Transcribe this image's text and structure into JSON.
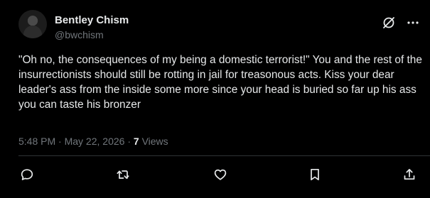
{
  "author": {
    "display_name": "Bentley Chism",
    "handle": "@bwchism",
    "avatar_icon": "avatar"
  },
  "header_icons": [
    "grok-icon",
    "more-icon"
  ],
  "tweet": {
    "text": "\"Oh no, the consequences of my being a domestic terrorist!\" You and the rest of the insurrectionists should still be rotting in jail for treasonous acts. Kiss your dear leader's ass from the inside some more since your head is buried so far up his ass you can taste his bronzer"
  },
  "meta": {
    "time": "5:48 PM",
    "separator": "·",
    "date": "May 22, 2026",
    "views_count": "7",
    "views_label": "Views"
  },
  "actions": [
    "reply-icon",
    "retweet-icon",
    "like-icon",
    "bookmark-icon",
    "share-icon"
  ],
  "colors": {
    "background": "#000000",
    "text": "#e7e9ea",
    "muted": "#71767b",
    "divider": "#2f3336"
  }
}
